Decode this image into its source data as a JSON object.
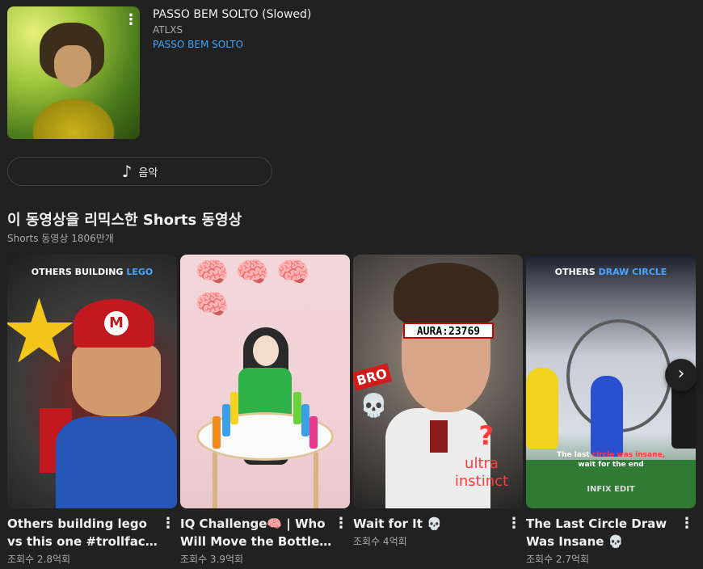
{
  "song": {
    "title": "PASSO BEM SOLTO (Slowed)",
    "artist": "ATLXS",
    "album": "PASSO BEM SOLTO",
    "menu_icon": "more-vert-icon"
  },
  "music_button": {
    "label": "음악",
    "icon": "music-note-icon"
  },
  "shelf": {
    "title": "이 동영상을 리믹스한 Shorts 동영상",
    "subtitle": "Shorts 동영상 1806만개"
  },
  "shorts": [
    {
      "title": "Others building lego vs this one #trollface #ed…",
      "views": "조회수 2.8억회",
      "overlay": "OTHERS BUILDING",
      "overlay_hl": "LEGO"
    },
    {
      "title": "IQ Challenge🧠 | Who Will Move the Bottles …",
      "views": "조회수 3.9억회",
      "emojis": "🧠🧠🧠🧠"
    },
    {
      "title": "Wait for It 💀",
      "views": "조회수 4억회",
      "aura": "AURA:23769",
      "bro": "BRO",
      "ultra": "ultra instinct",
      "question": "?"
    },
    {
      "title": "The Last Circle Draw Was Insane 💀",
      "views": "조회수 2.7억회",
      "overlay": "OTHERS",
      "overlay_hl": "DRAW CIRCLE",
      "caption_a": "The last",
      "caption_r": "circle was insane,",
      "caption_b": "wait for the end",
      "watermark": "INFIX EDIT"
    }
  ],
  "next_icon": "chevron-right-icon"
}
